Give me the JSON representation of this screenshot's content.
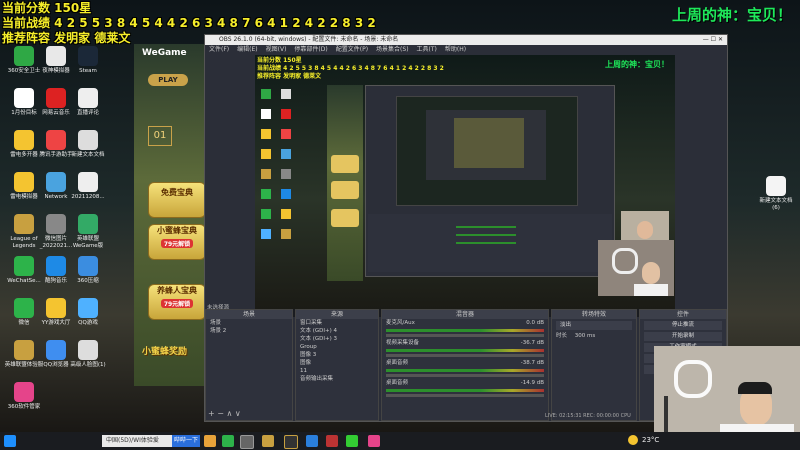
{
  "overlay": {
    "score": "当前分数 150星",
    "record": "当前战绩 4 2 5 5 3 8 4 5 4 4 2 6 3 4 8 7 6 4 1 2 4 2 2 8 3 2",
    "recommend": "推荐阵容 发明家 德莱文",
    "god": "上周的神：宝贝！"
  },
  "desktop_icons": [
    {
      "label": "360安全卫士",
      "color": "#2fa845"
    },
    {
      "label": "夜神模拟器",
      "color": "#e8e8e8"
    },
    {
      "label": "Steam",
      "color": "#1b2838"
    },
    {
      "label": "1月份目标",
      "color": "#ffffff"
    },
    {
      "label": "网易云音乐",
      "color": "#d22"
    },
    {
      "label": "直播评论",
      "color": "#eee"
    },
    {
      "label": "雷电多开器",
      "color": "#f4c430"
    },
    {
      "label": "腾讯手游助手",
      "color": "#e44"
    },
    {
      "label": "新建文本文档",
      "color": "#ddd"
    },
    {
      "label": "雷电模拟器",
      "color": "#f4c430"
    },
    {
      "label": "Network",
      "color": "#4aa3df"
    },
    {
      "label": "20211208...",
      "color": "#eee"
    },
    {
      "label": "League of Legends",
      "color": "#c8a040"
    },
    {
      "label": "微信图片_2022021...",
      "color": "#888"
    },
    {
      "label": "英雄联盟WeGame版",
      "color": "#3a6"
    },
    {
      "label": "WeChatSe...",
      "color": "#2db34a"
    },
    {
      "label": "酷狗音乐",
      "color": "#1e8ae6"
    },
    {
      "label": "360压缩",
      "color": "#3b8de0"
    },
    {
      "label": "微信",
      "color": "#2db34a"
    },
    {
      "label": "YY游戏大厅",
      "color": "#f4c430"
    },
    {
      "label": "QQ游戏",
      "color": "#4fb1ff"
    },
    {
      "label": "英雄联盟体验服",
      "color": "#c8a040"
    },
    {
      "label": "QQ浏览器",
      "color": "#3f8ef0"
    },
    {
      "label": "高级人脸图(1)",
      "color": "#ddd"
    },
    {
      "label": "360软件管家",
      "color": "#e5448a"
    }
  ],
  "right_icon": {
    "label": "新建文本文档(6)"
  },
  "wegame": {
    "logo": "WeGame",
    "play": "PLAY",
    "level": "01",
    "btn1": "免费宝典",
    "btn2": "小蜜蜂宝典",
    "btn2_price": "79元解锁",
    "btn3": "养蜂人宝典",
    "btn3_price": "79元解锁",
    "banner": "小蜜蜂奖励"
  },
  "obs": {
    "title": "OBS 26.1.0 (64-bit, windows) - 配置文件: 未命名 - 场景: 未命名",
    "menu": [
      "文件(F)",
      "编辑(E)",
      "视图(V)",
      "停靠部件(D)",
      "配置文件(P)",
      "场景集合(S)",
      "工具(T)",
      "帮助(H)"
    ],
    "scenes_header": "场景",
    "scenes": [
      "场景",
      "场景 2"
    ],
    "sources_header": "来源",
    "sources": [
      "窗口采集",
      "文本 (GDI+) 4",
      "文本 (GDI+) 3",
      "Group",
      "图像 3",
      "图像",
      "11",
      "音频输出采集"
    ],
    "mixer_header": "混音器",
    "mixer": [
      {
        "name": "麦克风/Aux",
        "db": "0.0 dB"
      },
      {
        "name": "视频采集设备",
        "db": "-36.7 dB"
      },
      {
        "name": "桌面音频",
        "db": "-38.7 dB"
      },
      {
        "name": "桌面音频",
        "db": "-14.9 dB"
      }
    ],
    "transitions_header": "转场特效",
    "transition": "淡出",
    "duration_label": "时长",
    "duration": "300 ms",
    "controls_header": "控件",
    "controls": [
      "停止推流",
      "开始录制",
      "工作室模式",
      "设置",
      "退出"
    ],
    "status": "LIVE: 02:15:31  REC: 00:00:00  CPU",
    "selected_source": "未选择源"
  },
  "taskbar": {
    "search_text": "中国(5D)/WI体验爱",
    "search_label": "哔哔一下",
    "weather": "23°C"
  }
}
